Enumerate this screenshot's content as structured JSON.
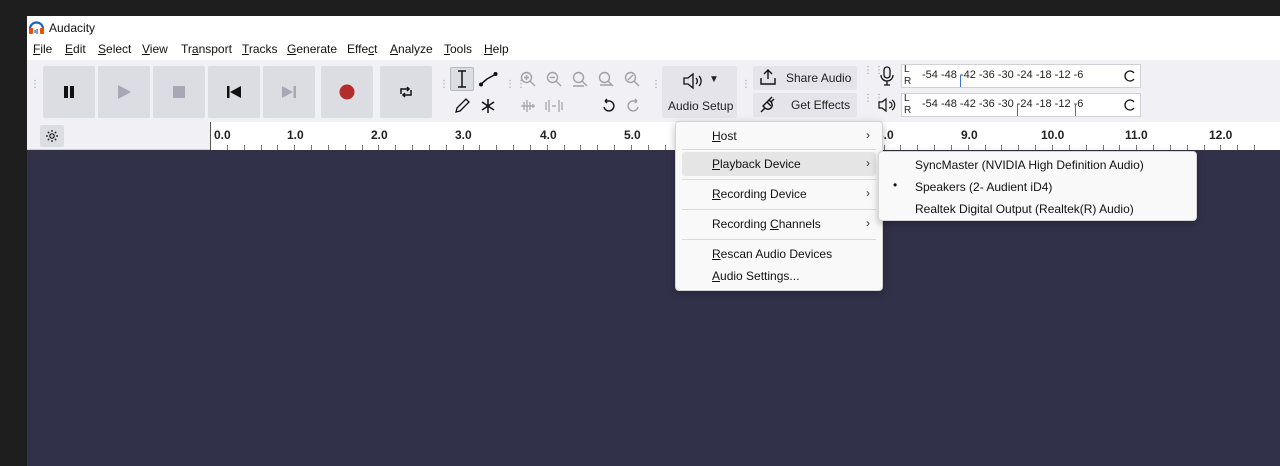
{
  "window": {
    "title": "Audacity"
  },
  "menubar": {
    "items": [
      {
        "label": "File"
      },
      {
        "label": "Edit"
      },
      {
        "label": "Select"
      },
      {
        "label": "View"
      },
      {
        "label": "Transport"
      },
      {
        "label": "Tracks"
      },
      {
        "label": "Generate"
      },
      {
        "label": "Effect"
      },
      {
        "label": "Analyze"
      },
      {
        "label": "Tools"
      },
      {
        "label": "Help"
      }
    ]
  },
  "toolbar": {
    "audio_setup_label": "Audio Setup",
    "share_audio_label": "Share Audio",
    "get_effects_label": "Get Effects",
    "meter_ticks": "-54  -48  -42  -36  -30  -24  -18  -12   -6",
    "meter_left": "L",
    "meter_right": "R"
  },
  "ruler": {
    "ticks": [
      "0.0",
      "1.0",
      "2.0",
      "3.0",
      "4.0",
      "5.0",
      "8.0",
      "9.0",
      "10.0",
      "11.0",
      "12.0"
    ]
  },
  "audio_setup_menu": {
    "items": [
      {
        "label": "Host",
        "has_submenu": true
      },
      {
        "label": "Playback Device",
        "has_submenu": true
      },
      {
        "label": "Recording Device",
        "has_submenu": true
      },
      {
        "label": "Recording Channels",
        "has_submenu": true
      },
      {
        "label": "Rescan Audio Devices",
        "has_submenu": false
      },
      {
        "label": "Audio Settings...",
        "has_submenu": false
      }
    ]
  },
  "playback_device_submenu": {
    "items": [
      {
        "label": "SyncMaster (NVIDIA High Definition Audio)",
        "selected": false
      },
      {
        "label": "Speakers (2- Audient iD4)",
        "selected": true
      },
      {
        "label": "Realtek Digital Output (Realtek(R) Audio)",
        "selected": false
      }
    ]
  },
  "colors": {
    "track_bg": "#31314a",
    "record": "#b22c2c",
    "toolbar_bg": "#f0f0f5"
  }
}
